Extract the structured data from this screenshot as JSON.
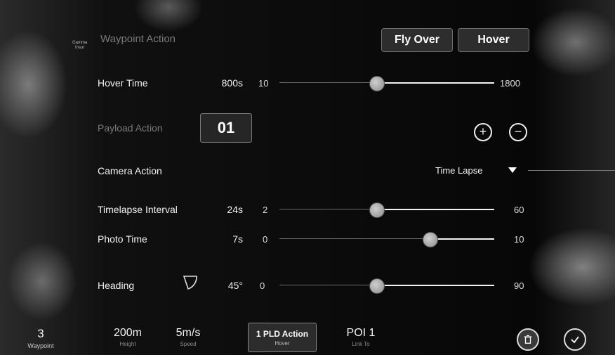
{
  "header": {
    "logo_line1": "Gamma",
    "logo_line2": "Insur",
    "title": "Waypoint Action",
    "fly_over": "Fly Over",
    "hover": "Hover"
  },
  "hover_time": {
    "label": "Hover Time",
    "value": "800s",
    "min": "10",
    "max": "1800",
    "level": 0.45
  },
  "payload": {
    "label": "Payload Action",
    "index": "01",
    "add": "+",
    "remove": "−"
  },
  "camera": {
    "label": "Camera Action",
    "value": "Time Lapse"
  },
  "timelapse_interval": {
    "label": "Timelapse Interval",
    "value": "24s",
    "min": "2",
    "max": "60",
    "level": 0.45
  },
  "photo_time": {
    "label": "Photo Time",
    "value": "7s",
    "min": "0",
    "max": "10",
    "level": 0.7
  },
  "heading": {
    "label": "Heading",
    "value": "45°",
    "min": "0",
    "max": "90",
    "level": 0.45
  },
  "bottom": {
    "waypoint_value": "3",
    "waypoint_label": "Waypoint",
    "height_value": "200m",
    "height_label": "Height",
    "speed_value": "5m/s",
    "speed_label": "Speed",
    "pld_value": "1 PLD Action",
    "pld_label": "Hover",
    "poi_value": "POI 1",
    "poi_label": "Link To"
  }
}
